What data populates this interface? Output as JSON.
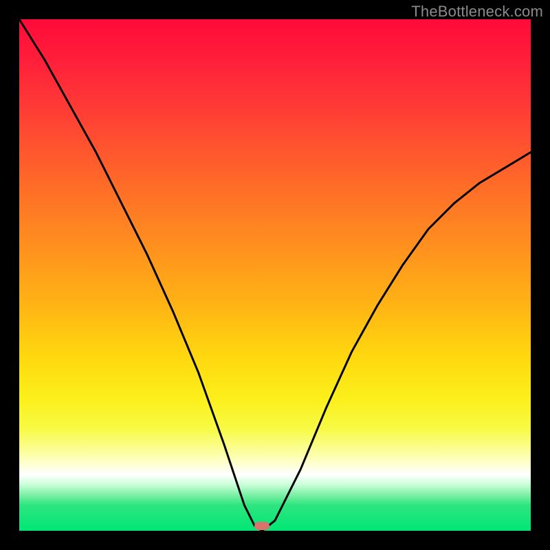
{
  "watermark": "TheBottleneck.com",
  "marker": {
    "x_pct": 47.5,
    "y_pct": 99.0
  },
  "chart_data": {
    "type": "line",
    "title": "",
    "xlabel": "",
    "ylabel": "",
    "xlim": [
      0,
      100
    ],
    "ylim": [
      0,
      100
    ],
    "grid": false,
    "legend": false,
    "series": [
      {
        "name": "bottleneck-curve",
        "x": [
          0,
          5,
          10,
          15,
          20,
          25,
          30,
          35,
          40,
          44,
          46,
          47.5,
          50,
          55,
          60,
          65,
          70,
          75,
          80,
          85,
          90,
          95,
          100
        ],
        "values": [
          100,
          92,
          83,
          74,
          64,
          54,
          43,
          31,
          17,
          5,
          1,
          0,
          2,
          12,
          24,
          35,
          44,
          52,
          59,
          64,
          68,
          71,
          74
        ]
      }
    ],
    "background_gradient_stops": [
      {
        "pct": 0,
        "color": "#ff0a3a"
      },
      {
        "pct": 8,
        "color": "#ff1f3a"
      },
      {
        "pct": 18,
        "color": "#ff3d35"
      },
      {
        "pct": 32,
        "color": "#ff6a28"
      },
      {
        "pct": 44,
        "color": "#ff8f1f"
      },
      {
        "pct": 56,
        "color": "#ffb414"
      },
      {
        "pct": 66,
        "color": "#ffd80f"
      },
      {
        "pct": 74,
        "color": "#fcef1a"
      },
      {
        "pct": 80,
        "color": "#f7fa44"
      },
      {
        "pct": 85,
        "color": "#fcffa6"
      },
      {
        "pct": 89,
        "color": "#ffffff"
      },
      {
        "pct": 91,
        "color": "#c9ffd8"
      },
      {
        "pct": 93,
        "color": "#7cf0a5"
      },
      {
        "pct": 95,
        "color": "#2de57e"
      },
      {
        "pct": 100,
        "color": "#00e676"
      }
    ],
    "marker": {
      "x": 47.5,
      "y": 0,
      "color": "#d9736b"
    }
  }
}
